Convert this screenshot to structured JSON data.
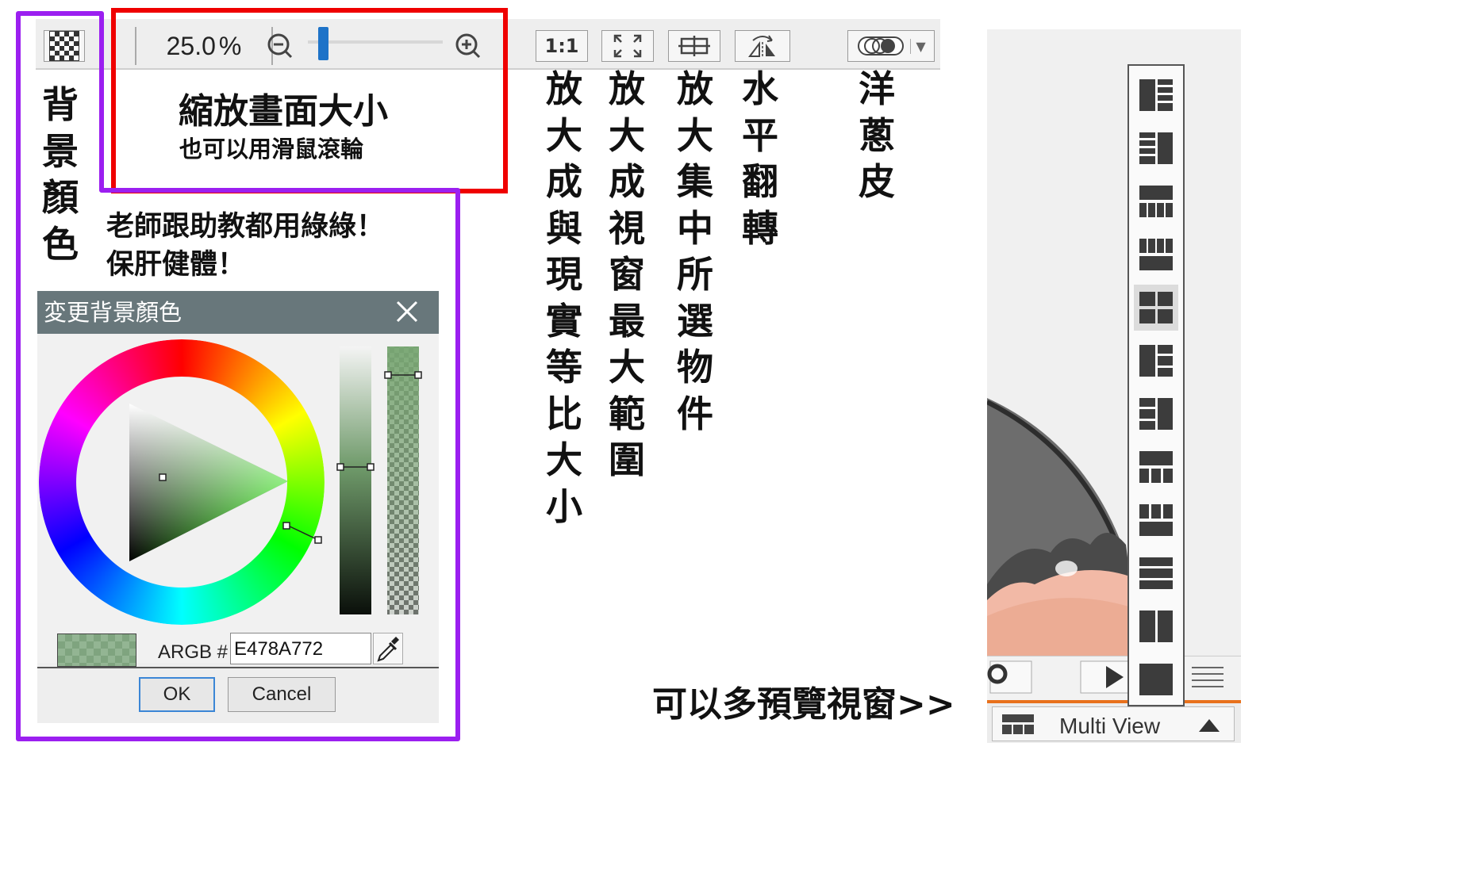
{
  "toolbar": {
    "zoom_value": "25.0",
    "zoom_unit": "%",
    "zoom_slider_level_percent": 8,
    "btn_1to1": "1:1",
    "accent_color": "#1e73c8"
  },
  "annotations": {
    "bg_color_vertical": [
      "背",
      "景",
      "顏",
      "色"
    ],
    "zoom_title": "縮放畫面大小",
    "zoom_subtitle": "也可以用滑鼠滾輪",
    "teacher_line1": "老師跟助教都用綠綠！",
    "teacher_line2": "保肝健體！",
    "col_actual": [
      "放",
      "大",
      "成",
      "與",
      "現",
      "實",
      "等",
      "比",
      "大",
      "小"
    ],
    "col_fit": [
      "放",
      "大",
      "成",
      "視",
      "窗",
      "最",
      "大",
      "範",
      "圍"
    ],
    "col_selection": [
      "放",
      "大",
      "集",
      "中",
      "所",
      "選",
      "物",
      "件"
    ],
    "col_flip": [
      "水",
      "平",
      "翻",
      "轉"
    ],
    "col_onion": [
      "洋",
      "蔥",
      "皮"
    ],
    "multi_preview": "可以多預覽視窗>>"
  },
  "dialog": {
    "title": "変更背景顏色",
    "argb_label": "ARGB #",
    "argb_value": "E478A772",
    "ok_label": "OK",
    "cancel_label": "Cancel",
    "selected_color": "#78A772"
  },
  "right_panel": {
    "multi_view_label": "Multi View",
    "layout_icons": [
      "layout-1",
      "layout-2",
      "layout-3",
      "layout-4",
      "layout-5",
      "layout-6",
      "layout-7",
      "layout-8",
      "layout-9",
      "layout-10",
      "layout-11",
      "layout-12"
    ],
    "selected_layout_index": 4
  },
  "colors": {
    "red_frame": "#ef0000",
    "purple_frame": "#9b1ff0",
    "dialog_title_bg": "#68777b",
    "timeline_orange": "#e8711c"
  }
}
